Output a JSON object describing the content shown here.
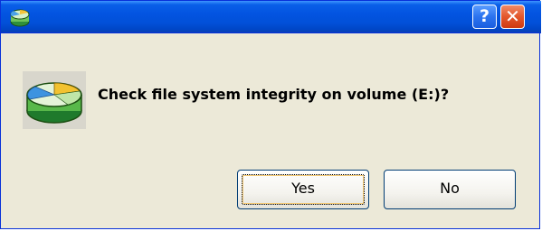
{
  "dialog": {
    "title": "",
    "help_button_label": "?",
    "close_button_label": "✕",
    "message": "Check file system integrity on volume (E:)?",
    "icon": "disk-check-icon",
    "buttons": {
      "yes_label": "Yes",
      "no_label": "No"
    }
  },
  "colors": {
    "titlebar": "#0054e3",
    "window_body": "#ece9d8",
    "close_button": "#e3572c",
    "help_button": "#2b73ef",
    "button_border": "#003c74"
  }
}
